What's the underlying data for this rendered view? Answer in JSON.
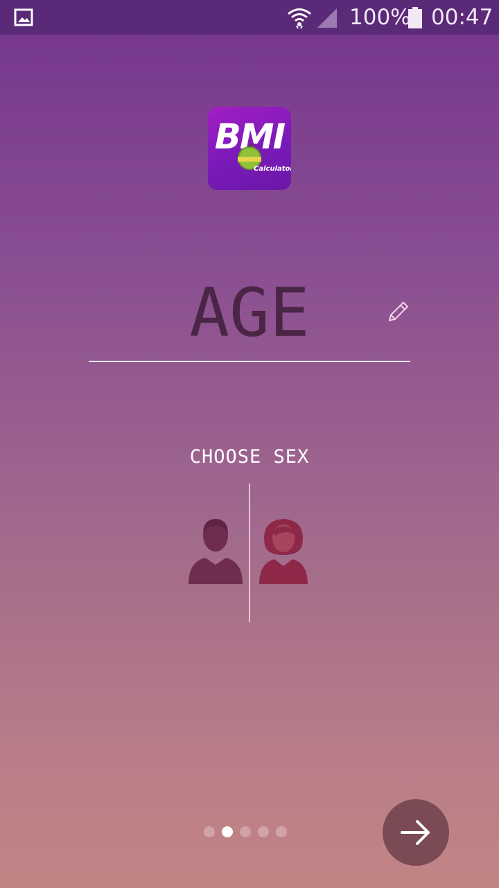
{
  "status_bar": {
    "battery_percent": "100%",
    "time": "00:47",
    "icons": [
      "gallery-icon",
      "wifi-icon",
      "signal-icon",
      "battery-icon"
    ]
  },
  "logo": {
    "title": "BMI",
    "subtitle": "Calculator",
    "icon": "apple-measuring-tape-icon"
  },
  "age": {
    "label": "AGE",
    "edit_icon": "pencil-icon"
  },
  "sex": {
    "label": "CHOOSE SEX",
    "options": [
      "male-icon",
      "female-icon"
    ]
  },
  "pager": {
    "total": 5,
    "current": 2
  },
  "next_button": {
    "icon": "arrow-right-icon"
  },
  "colors": {
    "status_bar": "#5a2a78",
    "gradient_top": "#74358c",
    "gradient_bottom": "#c28585",
    "male_icon": "#6e2c4e",
    "female_icon": "#8e2848",
    "next_button": "#7a4a55"
  }
}
